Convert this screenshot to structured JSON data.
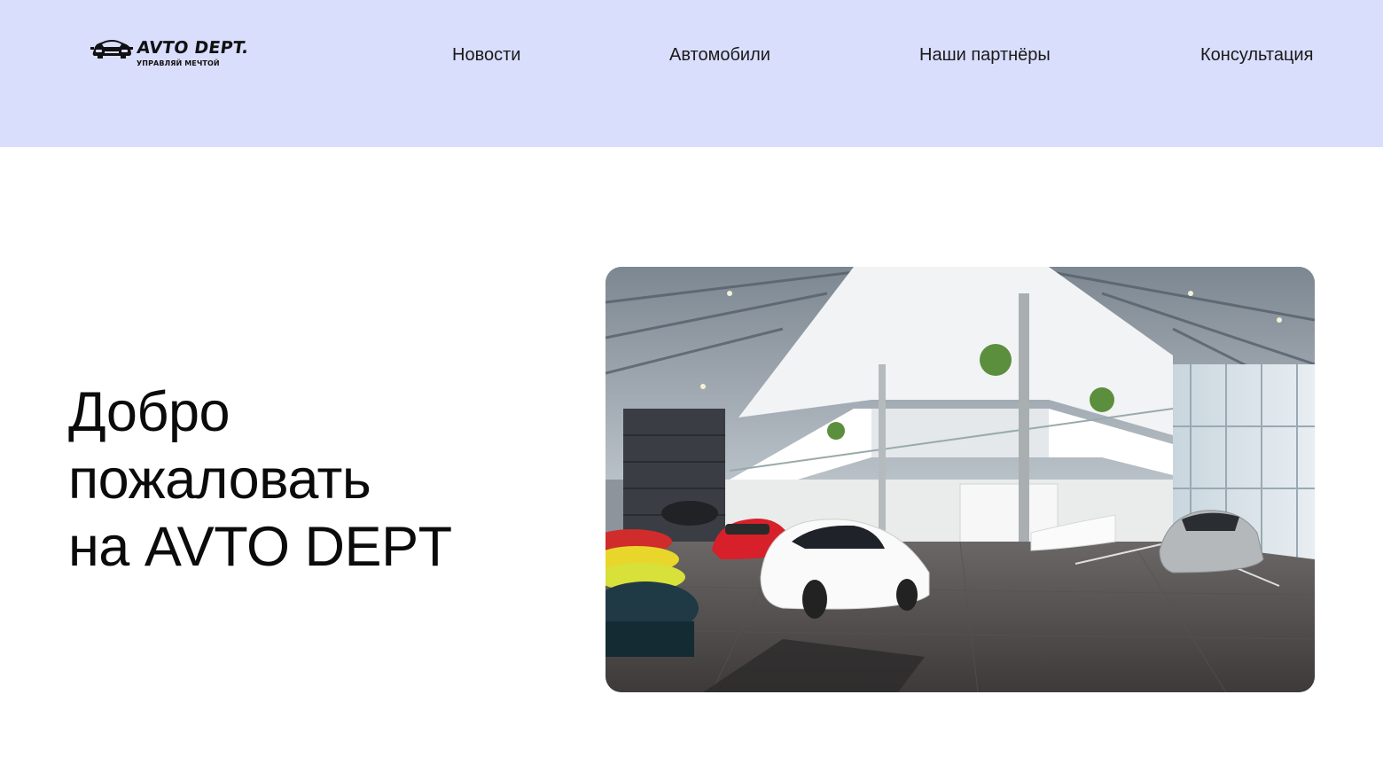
{
  "header": {
    "background": "#dadefd",
    "logo": {
      "title": "AVTO DEPT.",
      "tagline": "УПРАВЛЯЙ МЕЧТОЙ",
      "icon": "car-icon"
    },
    "nav": [
      {
        "label": "Новости"
      },
      {
        "label": "Автомобили"
      },
      {
        "label": "Наши партнёры"
      },
      {
        "label": "Консультация"
      }
    ]
  },
  "hero": {
    "title_lines": [
      "Добро",
      "пожаловать",
      "на AVTO DEPT"
    ],
    "image": "car-showroom-photo"
  }
}
